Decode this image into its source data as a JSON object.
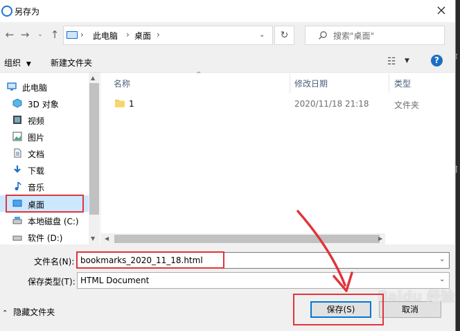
{
  "dialog": {
    "title": "另存为"
  },
  "address_bar": {
    "path": [
      "此电脑",
      "桌面"
    ],
    "search_placeholder": "搜索\"桌面\""
  },
  "toolbar": {
    "organize": "组织",
    "new_folder": "新建文件夹"
  },
  "nav": {
    "items": [
      {
        "label": "此电脑",
        "icon": "computer-icon"
      },
      {
        "label": "3D 对象",
        "icon": "cube-icon"
      },
      {
        "label": "视频",
        "icon": "video-icon"
      },
      {
        "label": "图片",
        "icon": "picture-icon"
      },
      {
        "label": "文档",
        "icon": "document-icon"
      },
      {
        "label": "下载",
        "icon": "download-icon"
      },
      {
        "label": "音乐",
        "icon": "music-icon"
      },
      {
        "label": "桌面",
        "icon": "desktop-icon",
        "selected": true
      },
      {
        "label": "本地磁盘 (C:)",
        "icon": "drive-icon"
      },
      {
        "label": "软件 (D:)",
        "icon": "drive-icon"
      }
    ]
  },
  "files": {
    "columns": [
      "名称",
      "修改日期",
      "类型"
    ],
    "rows": [
      {
        "name": "1",
        "modified": "2020/11/18 21:18",
        "type": "文件夹"
      }
    ]
  },
  "form": {
    "filename_label": "文件名(N):",
    "filename_value": "bookmarks_2020_11_18.html",
    "filetype_label": "保存类型(T):",
    "filetype_value": "HTML Document",
    "hide_folders": "隐藏文件夹",
    "save_button": "保存(S)",
    "cancel_button": "取消"
  },
  "watermark": "Baidu 经验",
  "colors": {
    "accent": "#1a6fc4",
    "annotation": "#e0343b",
    "folder": "#f5c94a"
  }
}
